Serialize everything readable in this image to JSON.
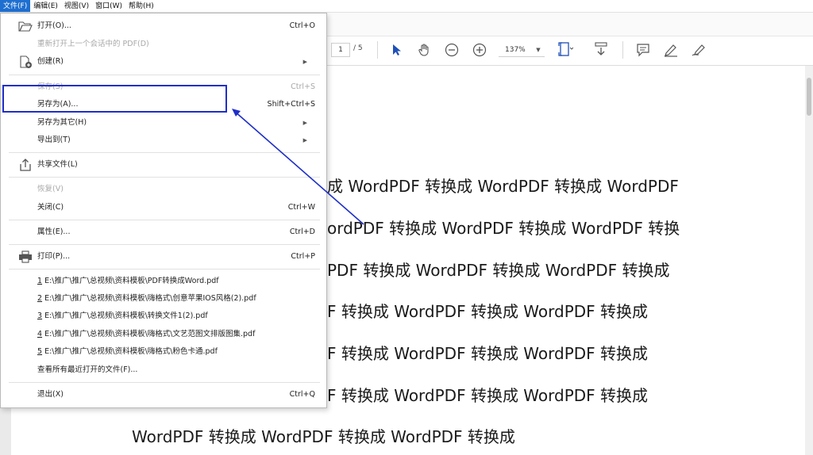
{
  "menubar": {
    "items": [
      "文件(F)",
      "编辑(E)",
      "视图(V)",
      "窗口(W)",
      "帮助(H)"
    ]
  },
  "toolbar": {
    "page_current": "1",
    "page_total": "/ 5",
    "zoom": "137%"
  },
  "file_menu": {
    "open": {
      "label": "打开(O)...",
      "shortcut": "Ctrl+O"
    },
    "reopen": {
      "label": "重新打开上一个会话中的 PDF(D)"
    },
    "create": {
      "label": "创建(R)"
    },
    "save": {
      "label": "保存(S)",
      "shortcut": "Ctrl+S"
    },
    "save_as": {
      "label": "另存为(A)...",
      "shortcut": "Shift+Ctrl+S"
    },
    "save_as_other": {
      "label": "另存为其它(H)"
    },
    "export_to": {
      "label": "导出到(T)"
    },
    "share": {
      "label": "共享文件(L)"
    },
    "revert": {
      "label": "恢复(V)"
    },
    "close": {
      "label": "关闭(C)",
      "shortcut": "Ctrl+W"
    },
    "properties": {
      "label": "属性(E)...",
      "shortcut": "Ctrl+D"
    },
    "print": {
      "label": "打印(P)...",
      "shortcut": "Ctrl+P"
    },
    "recent": [
      {
        "num": "1",
        "path": "E:\\推广\\推广\\总视频\\资料模板\\PDF转换成Word.pdf"
      },
      {
        "num": "2",
        "path": "E:\\推广\\推广\\总视频\\资料模板\\嗨格式\\创意苹果IOS风格(2).pdf"
      },
      {
        "num": "3",
        "path": "E:\\推广\\推广\\总视频\\资料模板\\转换文件1(2).pdf"
      },
      {
        "num": "4",
        "path": "E:\\推广\\推广\\总视频\\资料模板\\嗨格式\\文艺范图文排版图集.pdf"
      },
      {
        "num": "5",
        "path": "E:\\推广\\推广\\总视频\\资料模板\\嗨格式\\粉色卡通.pdf"
      }
    ],
    "view_all_recent": {
      "label": "查看所有最近打开的文件(F)..."
    },
    "exit": {
      "label": "退出(X)",
      "shortcut": "Ctrl+Q"
    }
  },
  "document": {
    "lines": [
      "成 WordPDF 转换成 WordPDF 转换成 WordPDF",
      "ordPDF 转换成 WordPDF 转换成 WordPDF 转换",
      "PDF 转换成 WordPDF 转换成 WordPDF 转换成",
      "F 转换成 WordPDF 转换成 WordPDF 转换成",
      "F 转换成 WordPDF 转换成 WordPDF 转换成",
      "F 转换成 WordPDF 转换成 WordPDF 转换成",
      "WordPDF 转换成 WordPDF 转换成 WordPDF 转换成"
    ]
  },
  "colors": {
    "menu_active_bg": "#1e6fd0",
    "annotation": "#1f2fc8",
    "disabled_text": "#a8a8a8"
  }
}
